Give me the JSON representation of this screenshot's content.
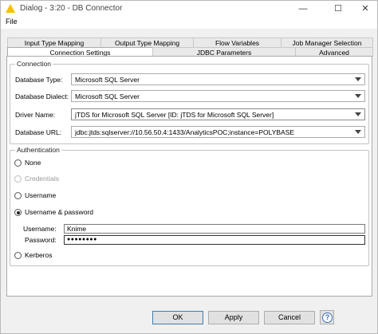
{
  "window": {
    "title": "Dialog - 3:20 - DB Connector"
  },
  "menu": {
    "file": "File"
  },
  "tabs": {
    "row1": [
      "Input Type Mapping",
      "Output Type Mapping",
      "Flow Variables",
      "Job Manager Selection"
    ],
    "row2": [
      "Connection Settings",
      "JDBC Parameters",
      "Advanced"
    ],
    "selected": "Connection Settings"
  },
  "connection": {
    "group_label": "Connection",
    "database_type_label": "Database Type:",
    "database_type_value": "Microsoft SQL Server",
    "database_dialect_label": "Database Dialect:",
    "database_dialect_value": "Microsoft SQL Server",
    "driver_name_label": "Driver Name:",
    "driver_name_value": "jTDS for Microsoft SQL Server [ID: jTDS for Microsoft SQL Server]",
    "database_url_label": "Database URL:",
    "database_url_value": "jdbc:jtds:sqlserver://10.56.50.4:1433/AnalyticsPOC;instance=POLYBASE"
  },
  "authentication": {
    "group_label": "Authentication",
    "options": [
      "None",
      "Credentials",
      "Username",
      "Username & password",
      "Kerberos"
    ],
    "selected": "Username & password",
    "username_label": "Username:",
    "username_value": "Knime",
    "password_label": "Password:",
    "password_value": "●●●●●●●●"
  },
  "buttons": {
    "ok": "OK",
    "apply": "Apply",
    "cancel": "Cancel",
    "help": "?"
  },
  "colors": {
    "title_icon": "#f2c200",
    "help_icon": "#3b6fb8",
    "ok_border": "#3c7fb1"
  }
}
